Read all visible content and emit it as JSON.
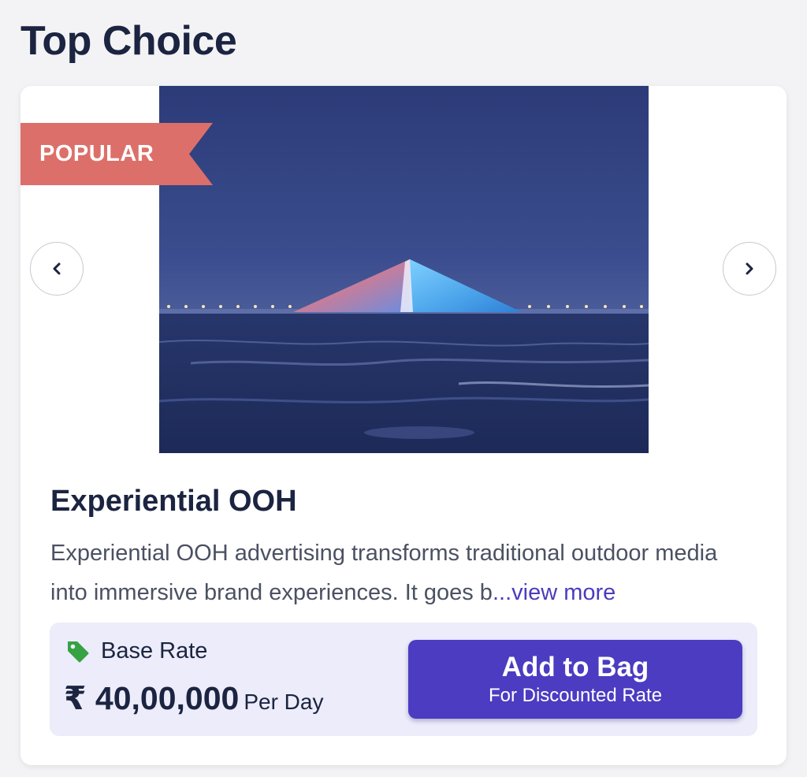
{
  "section": {
    "title": "Top Choice"
  },
  "card": {
    "badge": "POPULAR",
    "image_alt": "illuminated sea-link bridge pylon at night",
    "title": "Experiential OOH",
    "description": "Experiential OOH advertising transforms traditional outdoor media into immersive brand experiences. It goes b",
    "view_more": "...view more",
    "rate": {
      "label": "Base Rate",
      "price": "₹ 40,00,000",
      "unit": "Per Day"
    },
    "cta": {
      "main": "Add to Bag",
      "sub": "For Discounted Rate"
    }
  },
  "colors": {
    "primary": "#4b3cc1",
    "badge": "#dd6f6a",
    "tag_icon": "#35a244",
    "rate_bg": "#ececfa"
  },
  "icons": {
    "prev": "chevron-left-icon",
    "next": "chevron-right-icon",
    "tag": "price-tag-icon"
  }
}
